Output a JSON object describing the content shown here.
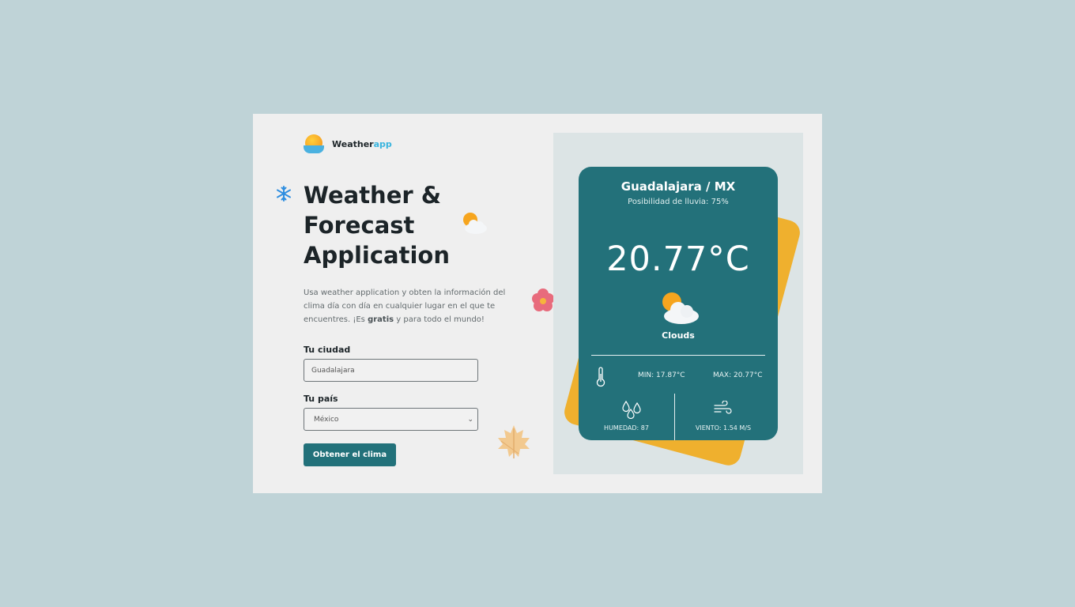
{
  "brand": {
    "name_main": "Weather",
    "name_accent": "app"
  },
  "hero": {
    "title_line1": "Weather &",
    "title_line2": "Forecast",
    "title_line3": "Application"
  },
  "description": {
    "part1": "Usa weather application y obten la información del clima día con día en cualquier lugar en el que te encuentres. ¡Es ",
    "bold": "gratis",
    "part2": " y para todo el mundo!"
  },
  "form": {
    "city_label": "Tu ciudad",
    "city_placeholder": "Guadalajara",
    "country_label": "Tu país",
    "country_selected": "México",
    "submit_label": "Obtener el clima"
  },
  "weather": {
    "location": "Guadalajara / MX",
    "rain_chance": "Posibilidad de lluvia: 75%",
    "temperature": "20.77°C",
    "condition": "Clouds",
    "min": "MIN: 17.87°C",
    "max": "MAX: 20.77°C",
    "humidity": "HUMEDAD: 87",
    "wind": "VIENTO: 1.54 M/S"
  },
  "icons": [
    "logo-icon",
    "snowflake-icon",
    "partly-cloudy-icon",
    "flower-icon",
    "maple-leaf-icon",
    "thermometer-icon",
    "droplets-icon",
    "wind-icon",
    "chevron-down-icon"
  ],
  "colors": {
    "background": "#bfd3d7",
    "accent": "#22717a",
    "card_back": "#efb02e",
    "brand_accent": "#38b4de"
  }
}
